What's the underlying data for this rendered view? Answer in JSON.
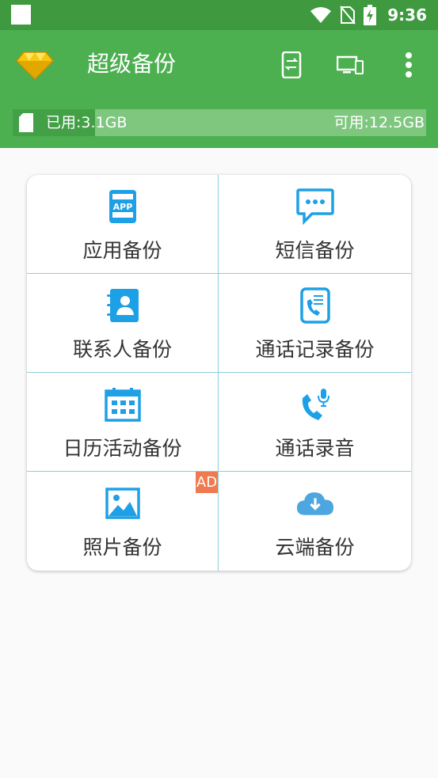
{
  "status_bar": {
    "time": "9:36"
  },
  "app_bar": {
    "title": "超级备份"
  },
  "storage": {
    "used_label": "已用:3.1GB",
    "free_label": "可用:12.5GB",
    "used_fraction": 0.2
  },
  "grid": {
    "items": [
      {
        "label": "应用备份",
        "icon": "app-icon"
      },
      {
        "label": "短信备份",
        "icon": "sms-icon"
      },
      {
        "label": "联系人备份",
        "icon": "contacts-icon"
      },
      {
        "label": "通话记录备份",
        "icon": "call-log-icon"
      },
      {
        "label": "日历活动备份",
        "icon": "calendar-icon"
      },
      {
        "label": "通话录音",
        "icon": "call-recording-icon"
      },
      {
        "label": "照片备份",
        "icon": "photo-icon",
        "badge": "AD"
      },
      {
        "label": "云端备份",
        "icon": "cloud-download-icon"
      }
    ]
  },
  "colors": {
    "primary": "#4caf50",
    "status_bar": "#3f9a3f",
    "icon_blue": "#1ea0e6",
    "divider": "#8ccfd6",
    "ad_badge": "#f07a4f"
  }
}
